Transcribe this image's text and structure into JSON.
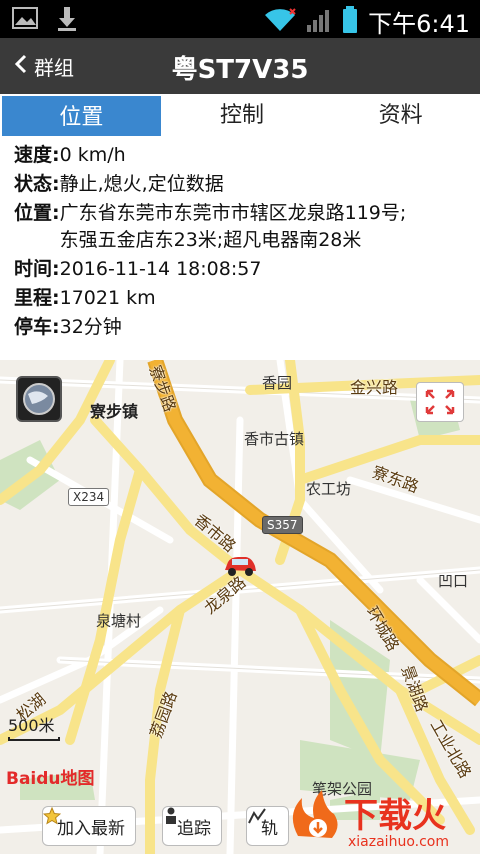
{
  "status": {
    "time": "下午6:41"
  },
  "header": {
    "back_label": "群组",
    "title": "粤ST7V35"
  },
  "tabs": [
    {
      "label": "位置",
      "active": true
    },
    {
      "label": "控制",
      "active": false
    },
    {
      "label": "资料",
      "active": false
    }
  ],
  "info": {
    "speed": {
      "key": "速度:",
      "value": "0 km/h"
    },
    "state": {
      "key": "状态:",
      "value": "静止,熄火,定位数据"
    },
    "location": {
      "key": "位置:",
      "value": "广东省东莞市东莞市市辖区龙泉路119号;东强五金店东23米;超凡电器南28米"
    },
    "time": {
      "key": "时间:",
      "value": "2016-11-14 18:08:57"
    },
    "mileage": {
      "key": "里程:",
      "value": "17021 km"
    },
    "parking": {
      "key": "停车:",
      "value": "32分钟"
    }
  },
  "map": {
    "places": {
      "liaobu": "寮步镇",
      "xiangyuan": "香园",
      "xiangshi_guzhen": "香市古镇",
      "nonggongfang": "农工坊",
      "quantang": "泉塘村",
      "aokou": "凹口",
      "bidi": "笔架公园"
    },
    "roads": {
      "jinxing": "金兴路",
      "liaodong": "寮东路",
      "xiangshi": "香市路",
      "longquan": "龙泉路",
      "lidu": "荔园路",
      "gongye_bei": "工业北路",
      "songhu": "松湖",
      "jingcun": "景湖路",
      "huanshi": "环城路",
      "liaonan": "寮步路"
    },
    "shields": {
      "x234": "X234",
      "s357": "S357"
    },
    "scale_label": "500米",
    "logo": "Baidu地图"
  },
  "actions": {
    "add_latest": "加入最新",
    "track": "追踪",
    "more": "轨"
  },
  "watermark": {
    "brand": "下载火",
    "url": "xiazaihuo.com"
  },
  "colors": {
    "tab_active": "#3a87cf",
    "header": "#3a3a3a",
    "major_road": "#f2b233",
    "car": "#e0302a"
  }
}
